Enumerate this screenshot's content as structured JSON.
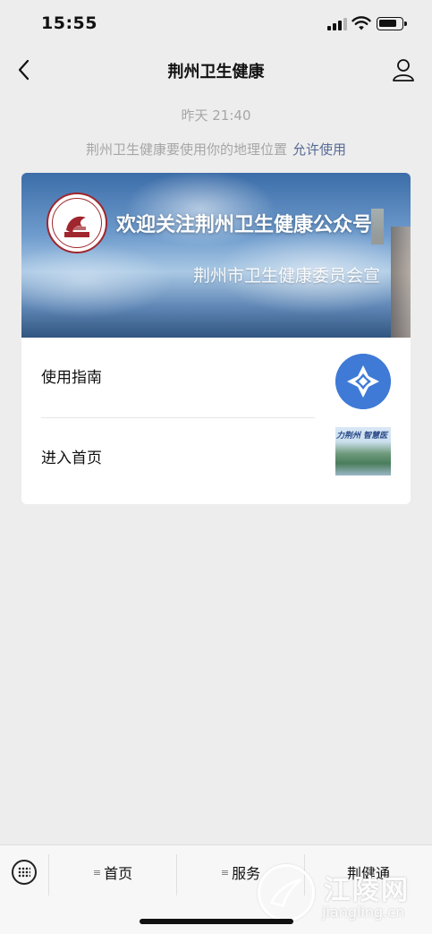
{
  "status_bar": {
    "time": "15:55"
  },
  "nav": {
    "title": "荆州卫生健康"
  },
  "chat": {
    "timestamp": "昨天 21:40",
    "location_request": "荆州卫生健康要使用你的地理位置",
    "allow_label": "允许使用"
  },
  "card": {
    "banner_title": "欢迎关注荆州卫生健康公众号",
    "banner_subtitle": "荆州市卫生健康委员会宣",
    "items": [
      {
        "label": "使用指南"
      },
      {
        "label": "进入首页",
        "thumb_text": "力荆州 智慧医"
      }
    ]
  },
  "bottom_menu": {
    "tabs": [
      {
        "label": "首页",
        "icon": "≡"
      },
      {
        "label": "服务",
        "icon": "≡"
      },
      {
        "label": "荆健通"
      }
    ]
  },
  "watermark": {
    "cn": "江陵网",
    "en": "jiangling.cn"
  },
  "colors": {
    "background": "#ededed",
    "link": "#576b95",
    "guide_icon": "#3f7ad6",
    "logo_red": "#a0262d"
  }
}
